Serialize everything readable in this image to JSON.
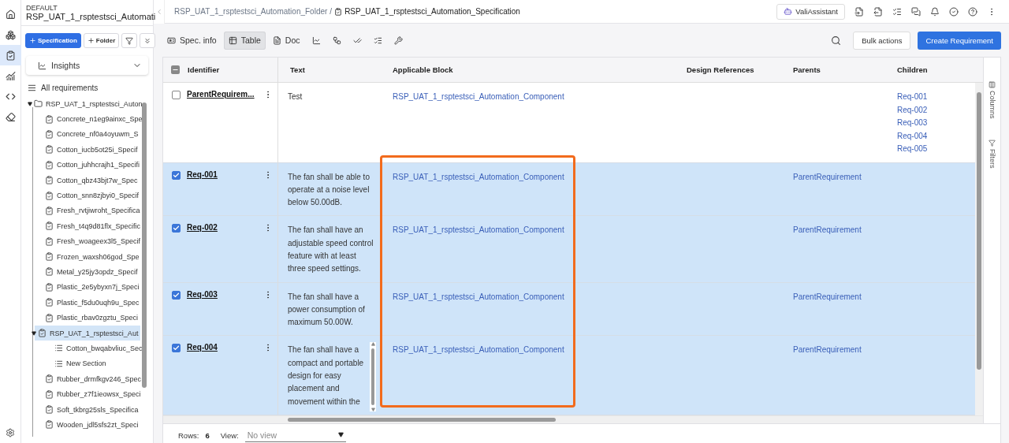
{
  "rail": {
    "items": [
      {
        "kind": "home",
        "selected": false
      },
      {
        "kind": "modules",
        "selected": false
      },
      {
        "kind": "specs",
        "selected": true
      },
      {
        "kind": "analytics",
        "selected": false
      },
      {
        "kind": "code",
        "selected": false
      },
      {
        "kind": "eraser",
        "selected": false
      }
    ],
    "settings": {
      "kind": "settings"
    }
  },
  "sidebar": {
    "workspace": {
      "label": "DEFAULT",
      "name": "RSP_UAT_1_rsptestsci_Automati"
    },
    "buttons": [
      {
        "kind": "primary",
        "label": "Specification"
      },
      {
        "kind": "secondary",
        "label": "Folder"
      },
      {
        "kind": "filter"
      },
      {
        "kind": "collapse"
      }
    ],
    "insights": {
      "label": "Insights"
    },
    "all_requirements": {
      "label": "All requirements"
    },
    "tree": [
      {
        "label": "RSP_UAT_1_rsptestsci_Auton",
        "kind": "folder",
        "expanded": true,
        "selected": false,
        "children": [
          {
            "label": "Concrete_n1eg9ainxc_Spe",
            "kind": "spec",
            "selected": false
          },
          {
            "label": "Concrete_nf0a4oyuwm_S",
            "kind": "spec",
            "selected": false
          },
          {
            "label": "Cotton_iucb5ot25i_Specif",
            "kind": "spec",
            "selected": false
          },
          {
            "label": "Cotton_juhhcrajh1_Specifi",
            "kind": "spec",
            "selected": false
          },
          {
            "label": "Cotton_qbz43bjt7w_Spec",
            "kind": "spec",
            "selected": false
          },
          {
            "label": "Cotton_snn8zjbyi0_Specif",
            "kind": "spec",
            "selected": false
          },
          {
            "label": "Fresh_rvtjiwroht_Specifica",
            "kind": "spec",
            "selected": false
          },
          {
            "label": "Fresh_t4q9d81flx_Specific",
            "kind": "spec",
            "selected": false
          },
          {
            "label": "Fresh_woageex3l5_Specif",
            "kind": "spec",
            "selected": false
          },
          {
            "label": "Frozen_waxsh06god_Spe",
            "kind": "spec",
            "selected": false
          },
          {
            "label": "Metal_y25jy3opdz_Specif",
            "kind": "spec",
            "selected": false
          },
          {
            "label": "Plastic_2e5ybyxn7j_Speci",
            "kind": "spec",
            "selected": false
          },
          {
            "label": "Plastic_f5du0uqh9u_Spec",
            "kind": "spec",
            "selected": false
          },
          {
            "label": "Plastic_rbav0zgztu_Speci",
            "kind": "spec",
            "selected": false
          },
          {
            "label": "RSP_UAT_1_rsptestsci_Aut",
            "kind": "spec",
            "expanded": true,
            "selected": true,
            "children": [
              {
                "label": "Cotton_bwqabvliuc_Sec",
                "kind": "section",
                "selected": false
              },
              {
                "label": "New Section",
                "kind": "section",
                "selected": false
              }
            ]
          },
          {
            "label": "Rubber_drmfkgv246_Spec",
            "kind": "spec",
            "selected": false
          },
          {
            "label": "Rubber_z7f1ieowsx_Speci",
            "kind": "spec",
            "selected": false
          },
          {
            "label": "Soft_tkbrg25sls_Specifica",
            "kind": "spec",
            "selected": false
          },
          {
            "label": "Wooden_jdl5sfs2zt_Speci",
            "kind": "spec",
            "selected": false
          }
        ]
      }
    ]
  },
  "breadcrumb": {
    "folder": "RSP_UAT_1_rsptestsci_Automation_Folder",
    "separator": "/",
    "current": "RSP_UAT_1_rsptestsci_Automation_Specification"
  },
  "header_actions": {
    "assistant": "ValiAssistant",
    "icons": [
      {
        "kind": "import"
      },
      {
        "kind": "export"
      },
      {
        "kind": "checklist"
      },
      {
        "kind": "chat"
      },
      {
        "kind": "bell"
      },
      {
        "kind": "approve"
      },
      {
        "kind": "help"
      },
      {
        "kind": "more"
      }
    ]
  },
  "tabs": [
    {
      "kind": "info",
      "label": "Spec. info",
      "selected": false
    },
    {
      "kind": "table",
      "label": "Table",
      "selected": true
    },
    {
      "kind": "doc",
      "label": "Doc",
      "selected": false
    },
    {
      "kind": "chart",
      "selected": false
    },
    {
      "kind": "graph",
      "selected": false
    },
    {
      "kind": "checks",
      "selected": false
    },
    {
      "kind": "form",
      "selected": false
    },
    {
      "kind": "tools",
      "selected": false
    }
  ],
  "toolbar": {
    "bulk_actions": "Bulk actions",
    "create": "Create Requirement"
  },
  "table": {
    "select_all": {
      "indeterminate": true
    },
    "columns": [
      "Identifier",
      "Text",
      "Applicable Block",
      "Design References",
      "Parents",
      "Children"
    ],
    "rows": [
      {
        "identifier": "ParentRequirem...",
        "checked": false,
        "text": "Test",
        "applicable_block": "RSP_UAT_1_rsptestsci_Automation_Component",
        "parents": [],
        "children": [
          "Req-001",
          "Req-002",
          "Req-003",
          "Req-004",
          "Req-005"
        ]
      },
      {
        "identifier": "Req-001",
        "checked": true,
        "text": "The fan shall be able to operate at a noise level below 50.00dB.",
        "applicable_block": "RSP_UAT_1_rsptestsci_Automation_Component",
        "parents": [
          "ParentRequirement"
        ],
        "children": []
      },
      {
        "identifier": "Req-002",
        "checked": true,
        "text": "The fan shall have an adjustable speed control feature with at least three speed settings.",
        "applicable_block": "RSP_UAT_1_rsptestsci_Automation_Component",
        "parents": [
          "ParentRequirement"
        ],
        "children": []
      },
      {
        "identifier": "Req-003",
        "checked": true,
        "text": "The fan shall have a power consumption of maximum 50.00W.",
        "applicable_block": "RSP_UAT_1_rsptestsci_Automation_Component",
        "parents": [
          "ParentRequirement"
        ],
        "children": []
      },
      {
        "identifier": "Req-004",
        "checked": true,
        "text": "The fan shall have a compact and portable design for easy placement and movement within the",
        "text_scrollable": true,
        "applicable_block": "RSP_UAT_1_rsptestsci_Automation_Component",
        "parents": [
          "ParentRequirement"
        ],
        "children": []
      }
    ]
  },
  "side_panel": [
    "Columns",
    "Filters"
  ],
  "footer": {
    "rows_label": "Rows:",
    "rows_count": "6",
    "view_label": "View:",
    "view_placeholder": "No view"
  }
}
